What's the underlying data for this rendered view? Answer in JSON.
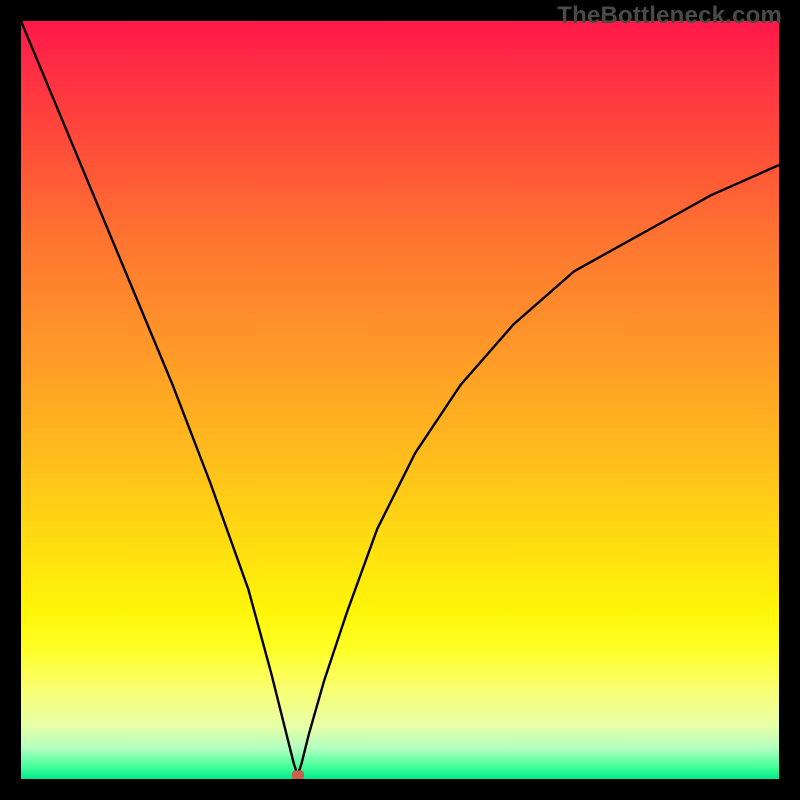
{
  "watermark": "TheBottleneck.com",
  "chart_data": {
    "type": "line",
    "title": "",
    "xlabel": "",
    "ylabel": "",
    "xlim": [
      0,
      100
    ],
    "ylim": [
      0,
      100
    ],
    "grid": false,
    "legend": false,
    "series": [
      {
        "name": "curve",
        "x": [
          0,
          5,
          10,
          15,
          20,
          25,
          30,
          33,
          35,
          36,
          36.5,
          37,
          38,
          40,
          43,
          47,
          52,
          58,
          65,
          73,
          82,
          91,
          100
        ],
        "values": [
          100,
          88,
          76,
          64,
          52,
          39,
          25,
          14,
          6,
          2,
          0.5,
          2,
          6,
          13,
          22,
          33,
          43,
          52,
          60,
          67,
          72,
          77,
          81
        ]
      }
    ],
    "marker": {
      "x": 36.5,
      "y": 0.5,
      "color": "#cc604c"
    },
    "gradient_bands": [
      {
        "stop": 0,
        "color": "#ff1848"
      },
      {
        "stop": 0.18,
        "color": "#ff5238"
      },
      {
        "stop": 0.44,
        "color": "#ff9a28"
      },
      {
        "stop": 0.7,
        "color": "#ffe010"
      },
      {
        "stop": 0.83,
        "color": "#feff28"
      },
      {
        "stop": 0.93,
        "color": "#e8ffa8"
      },
      {
        "stop": 1.0,
        "color": "#00e890"
      }
    ]
  }
}
